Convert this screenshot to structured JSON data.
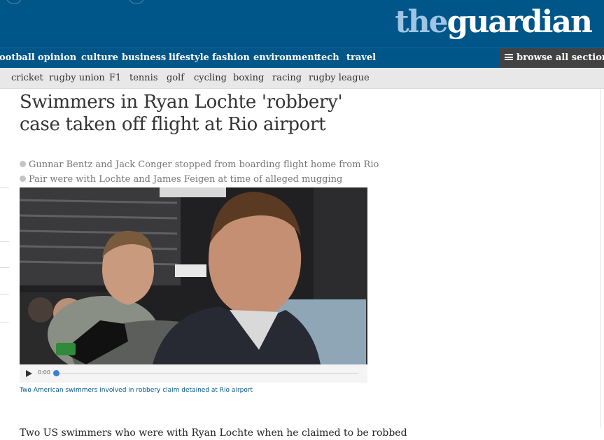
{
  "site": {
    "logo_prefix": "the",
    "logo_main": "guardian"
  },
  "nav": {
    "items": [
      "ootball",
      "opinion",
      "culture",
      "business",
      "lifestyle",
      "fashion",
      "environment",
      "tech",
      "travel"
    ],
    "browse_label": "browse all sections"
  },
  "subnav": {
    "items": [
      "cricket",
      "rugby union",
      "F1",
      "tennis",
      "golf",
      "cycling",
      "boxing",
      "racing",
      "rugby league"
    ]
  },
  "article": {
    "headline": "Swimmers in Ryan Lochte 'robbery' case taken off flight at Rio airport",
    "standfirst": [
      "Gunnar Bentz and Jack Conger stopped from boarding flight home from Rio",
      "Pair were with Lochte and James Feigen at time of alleged mugging"
    ],
    "video": {
      "time": "0:00",
      "progress": 0
    },
    "caption": "Two American swimmers involved in robbery claim detained at Rio airport",
    "body_first_line": "Two US swimmers who were with Ryan Lochte when he claimed to be robbed"
  },
  "colors": {
    "brand_blue": "#005689",
    "logo_accent": "#9fc5e4",
    "browse_bg": "#424242",
    "subnav_bg": "#e8e8e8"
  }
}
